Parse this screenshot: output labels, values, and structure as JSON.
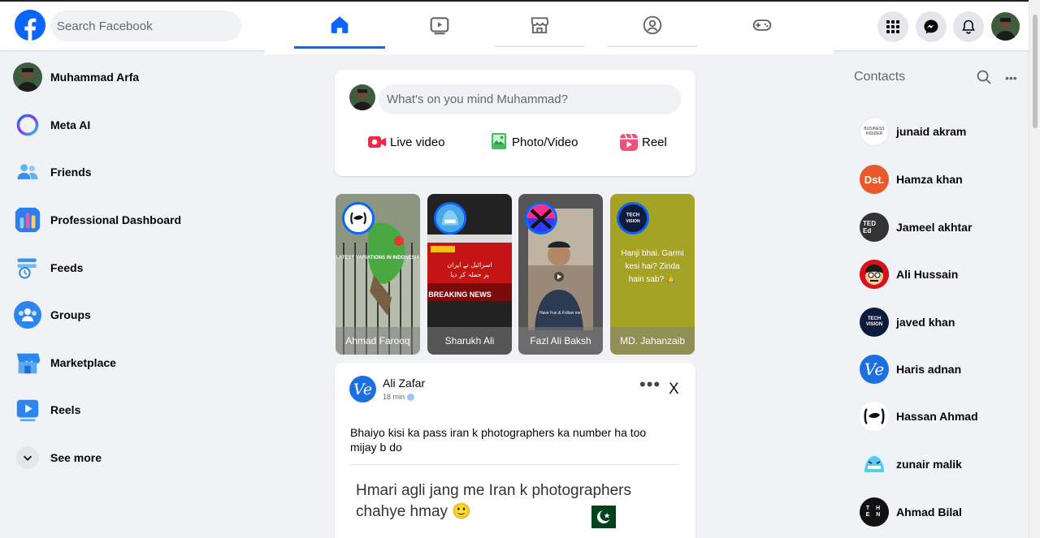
{
  "search": {
    "placeholder": "Search Facebook"
  },
  "nav_tabs": [
    {
      "name": "home",
      "active": true
    },
    {
      "name": "video",
      "active": false
    },
    {
      "name": "marketplace",
      "active": false
    },
    {
      "name": "groups",
      "active": false
    },
    {
      "name": "gaming",
      "active": false
    }
  ],
  "sidebar": {
    "items": [
      {
        "label": "Muhammad Arfa",
        "icon": "profile-avatar"
      },
      {
        "label": "Meta AI",
        "icon": "meta-ai-icon"
      },
      {
        "label": "Friends",
        "icon": "friends-icon"
      },
      {
        "label": "Professional Dashboard",
        "icon": "dashboard-icon"
      },
      {
        "label": "Feeds",
        "icon": "feeds-icon"
      },
      {
        "label": "Groups",
        "icon": "groups-icon"
      },
      {
        "label": "Marketplace",
        "icon": "marketplace-icon"
      },
      {
        "label": "Reels",
        "icon": "reels-icon"
      },
      {
        "label": "See more",
        "icon": "chevron-down-icon"
      }
    ]
  },
  "composer": {
    "placeholder": "What's on you mind Muhammad?",
    "actions": [
      {
        "label": "Live video",
        "icon": "live-video-icon"
      },
      {
        "label": "Photo/Video",
        "icon": "photo-icon"
      },
      {
        "label": "Reel",
        "icon": "reel-icon"
      }
    ]
  },
  "stories": [
    {
      "name": "Ahmad Farooq"
    },
    {
      "name": "Sharukh Ali"
    },
    {
      "name": "Fazl Ali Baksh"
    },
    {
      "name": "MD. Jahanzaib",
      "text": "Hanji bhai. Garmi kesi hai? Zinda hain sab? 🙏"
    }
  ],
  "post": {
    "author": "Ali Zafar",
    "avatar_text": "Ve",
    "time": "18 min",
    "more": "•••",
    "close": "X",
    "text": "Bhaiyo kisi ka pass iran k photographers ka number ha too mijay b do",
    "image_text": "Hmari agli jang me Iran k photographers chahye hmay 🙂"
  },
  "contacts": {
    "title": "Contacts",
    "list": [
      {
        "name": "junaid akram",
        "avatar_text": "BUSINESS INSIDER"
      },
      {
        "name": "Hamza khan",
        "avatar_text": "Dst."
      },
      {
        "name": "Jameel akhtar",
        "avatar_text": "TED Ed"
      },
      {
        "name": "Ali Hussain",
        "avatar_text": ""
      },
      {
        "name": "javed khan",
        "avatar_text": "TECH VISION"
      },
      {
        "name": "Haris adnan",
        "avatar_text": "Ve"
      },
      {
        "name": "Hassan Ahmad",
        "avatar_text": ""
      },
      {
        "name": "zunair malik",
        "avatar_text": ""
      },
      {
        "name": "Ahmad Bilal",
        "avatar_text": "T H E N"
      }
    ]
  },
  "colors": {
    "brand": "#0866ff",
    "background": "#f0f2f5"
  }
}
